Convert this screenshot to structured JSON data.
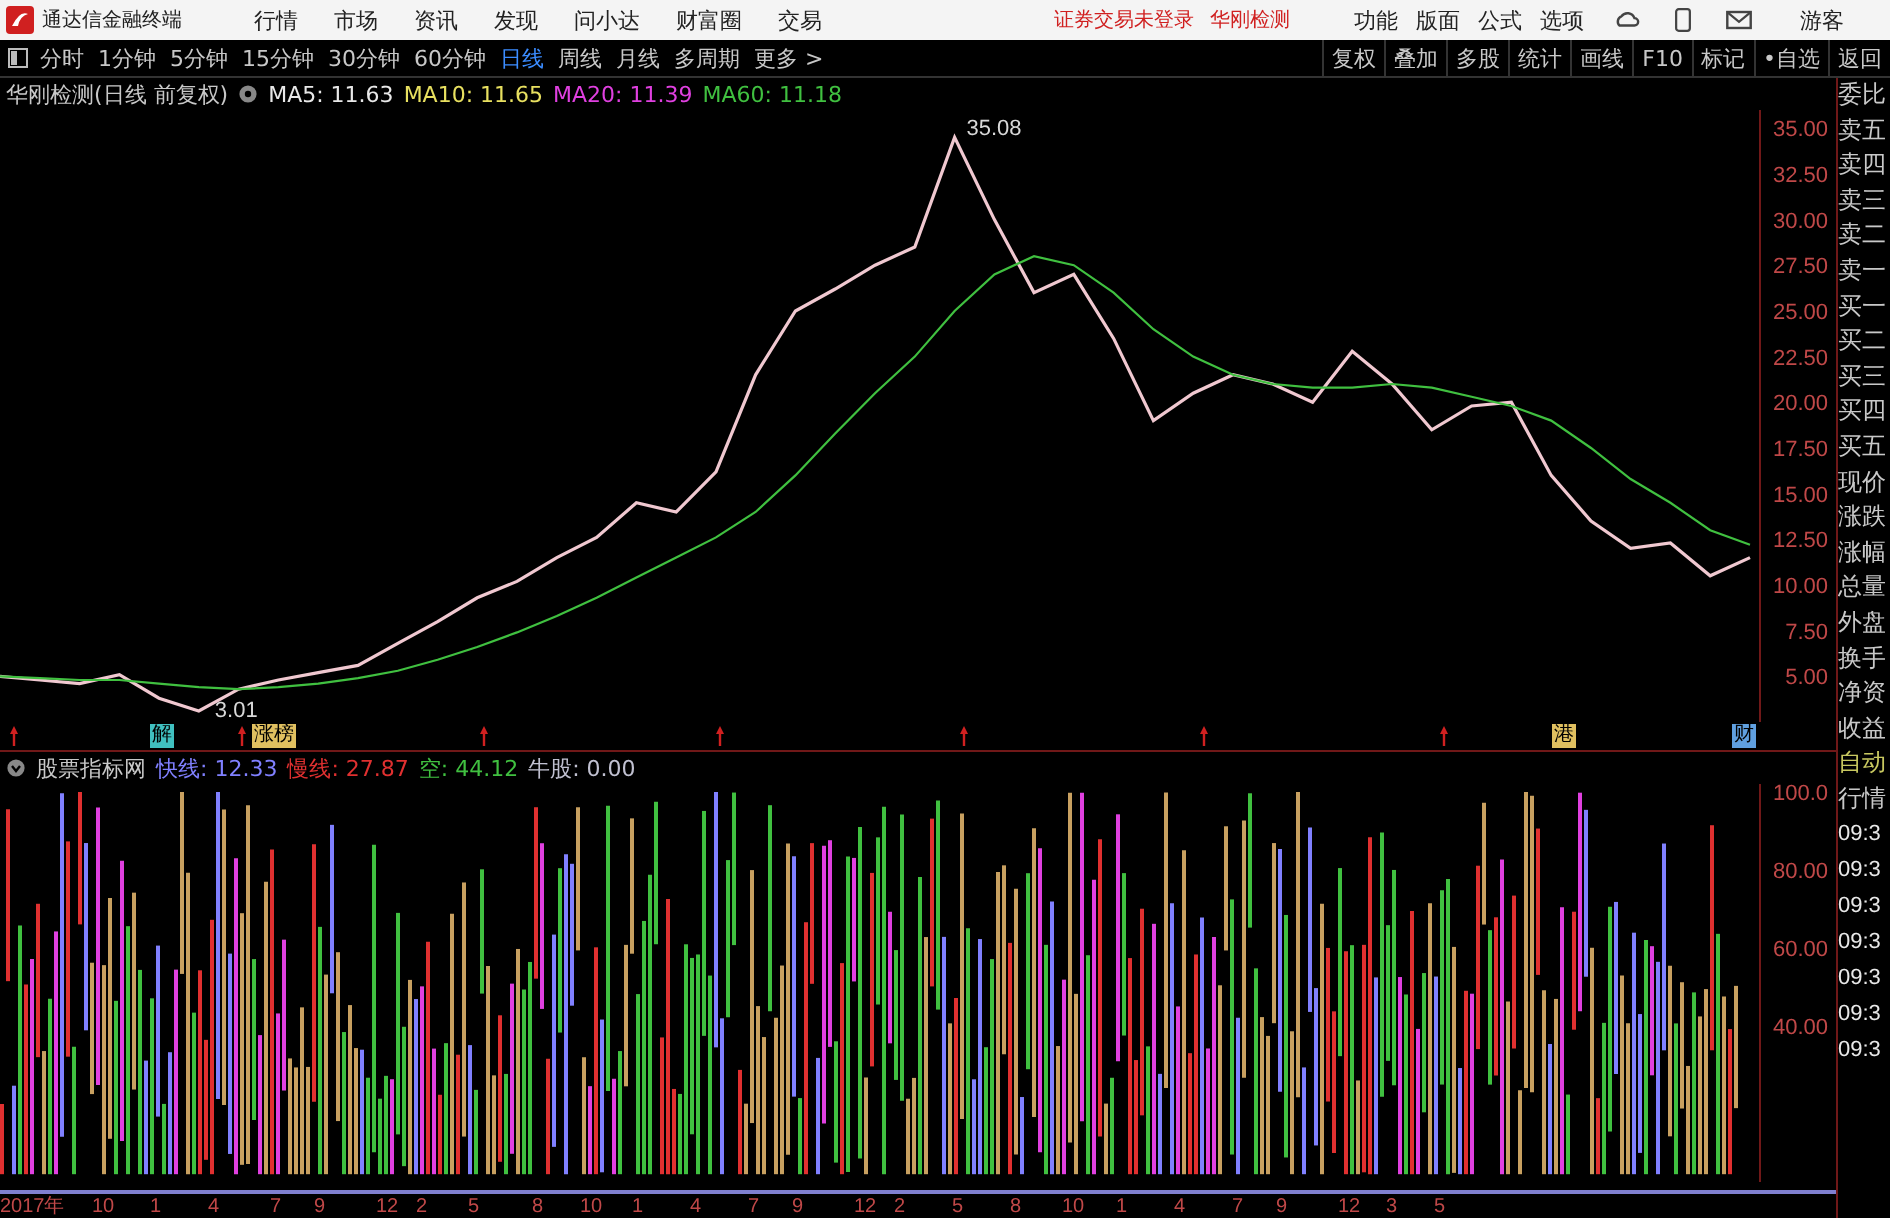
{
  "app_bar": {
    "title": "通达信金融终端",
    "menu": [
      "行情",
      "市场",
      "资讯",
      "发现",
      "问小达",
      "财富圈",
      "交易"
    ],
    "notice": "证券交易未登录",
    "account": "华刚检测",
    "tools": [
      "功能",
      "版面",
      "公式",
      "选项"
    ],
    "user": "游客"
  },
  "period_tabs": [
    {
      "label": "分时",
      "selected": false
    },
    {
      "label": "1分钟",
      "selected": false
    },
    {
      "label": "5分钟",
      "selected": false
    },
    {
      "label": "15分钟",
      "selected": false
    },
    {
      "label": "30分钟",
      "selected": false
    },
    {
      "label": "60分钟",
      "selected": false
    },
    {
      "label": "日线",
      "selected": true
    },
    {
      "label": "周线",
      "selected": false
    },
    {
      "label": "月线",
      "selected": false
    },
    {
      "label": "多周期",
      "selected": false
    },
    {
      "label": "更多 >",
      "selected": false
    }
  ],
  "toolbar_buttons": [
    "复权",
    "叠加",
    "多股",
    "统计",
    "画线",
    "F10",
    "标记",
    "•自选",
    "返回"
  ],
  "price_chart": {
    "title": "华刚检测(日线 前复权)",
    "ma_legend": [
      {
        "label": "MA5: 11.63",
        "color": "#e8e8e8"
      },
      {
        "label": "MA10: 11.65",
        "color": "#e8e060"
      },
      {
        "label": "MA20: 11.39",
        "color": "#e040e0"
      },
      {
        "label": "MA60: 11.18",
        "color": "#40c040"
      }
    ],
    "high_label": "35.08",
    "low_label": "3.01",
    "events": [
      {
        "label": "解",
        "color": "#40c0c0"
      },
      {
        "label": "涨榜",
        "color": "#e0c060"
      },
      {
        "label": "港",
        "color": "#e0c060"
      },
      {
        "label": "财",
        "color": "#60a0e0"
      }
    ],
    "axis_labels": [
      "35.00",
      "32.50",
      "30.00",
      "27.50",
      "25.00",
      "22.50",
      "20.00",
      "17.50",
      "15.00",
      "12.50",
      "10.00",
      "7.50",
      "5.00"
    ]
  },
  "indicator": {
    "title": "股票指标网",
    "legend": [
      {
        "label": "快线: 12.33",
        "color": "#8080ff"
      },
      {
        "label": "慢线: 27.87",
        "color": "#e03030"
      },
      {
        "label": "空: 44.12",
        "color": "#40c040"
      },
      {
        "label": "牛股: 0.00",
        "color": "#c0c0d0"
      }
    ],
    "axis_labels": [
      "100.0",
      "80.00",
      "60.00",
      "40.00"
    ]
  },
  "date_axis": [
    "2017年",
    "10",
    "1",
    "4",
    "7",
    "9",
    "12",
    "2",
    "5",
    "8",
    "10",
    "1",
    "4",
    "7",
    "9",
    "12",
    "2",
    "5",
    "8",
    "10",
    "1",
    "4",
    "7",
    "9",
    "12",
    "3",
    "5"
  ],
  "quote_panel": {
    "fields": [
      "委比",
      "卖五",
      "卖四",
      "卖三",
      "卖二",
      "卖一",
      "买一",
      "买二",
      "买三",
      "买四",
      "买五",
      "现价",
      "涨跌",
      "涨幅",
      "总量",
      "外盘",
      "换手",
      "净资",
      "收益"
    ],
    "modes": [
      "自动",
      "行情"
    ],
    "times": [
      "09:3",
      "09:3",
      "09:3",
      "09:3",
      "09:3",
      "09:3",
      "09:3"
    ]
  }
}
